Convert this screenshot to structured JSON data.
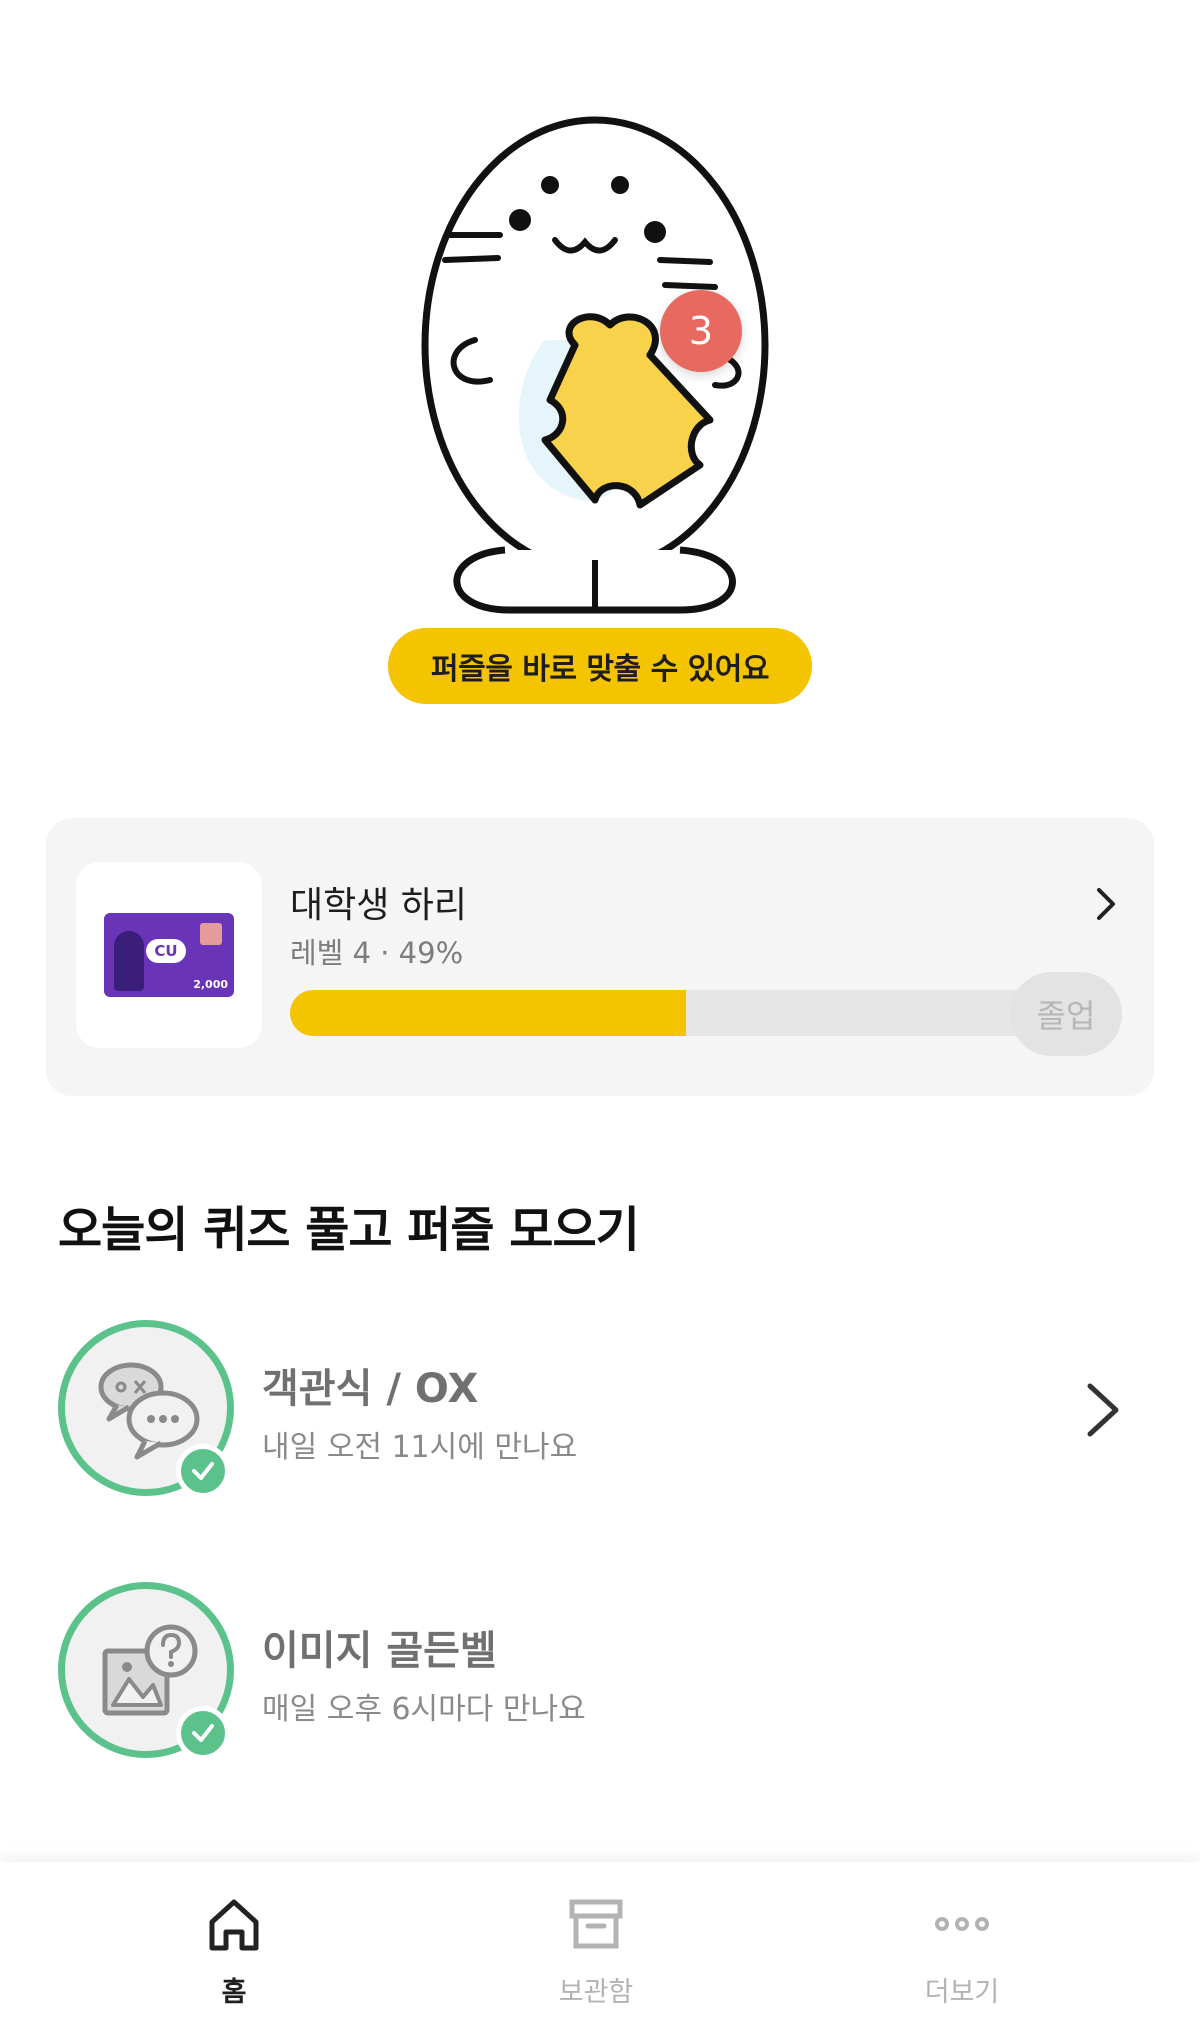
{
  "hero": {
    "puzzle_count": "3",
    "cta_label": "퍼즐을 바로 맞출 수 있어요"
  },
  "level_card": {
    "name": "대학생 하리",
    "sub": "레벨 4 · 49%",
    "progress_percent": 49,
    "graduate_label": "졸업",
    "coupon_brand": "CU",
    "coupon_amount": "2,000"
  },
  "section": {
    "title": "오늘의 퀴즈 풀고 퍼즐 모으기"
  },
  "quizzes": [
    {
      "title": "객관식 / OX",
      "sub": "내일 오전 11시에 만나요",
      "icon": "chat-bubbles-icon",
      "completed": true
    },
    {
      "title": "이미지 골든벨",
      "sub": "매일 오후 6시마다 만나요",
      "icon": "image-question-icon",
      "completed": true
    }
  ],
  "tabbar": {
    "items": [
      {
        "label": "홈",
        "icon": "home-icon",
        "active": true
      },
      {
        "label": "보관함",
        "icon": "archive-box-icon",
        "active": false
      },
      {
        "label": "더보기",
        "icon": "more-dots-icon",
        "active": false
      }
    ]
  },
  "colors": {
    "accent_yellow": "#f5c400",
    "badge_red": "#e8695f",
    "complete_green": "#5cc28b"
  }
}
